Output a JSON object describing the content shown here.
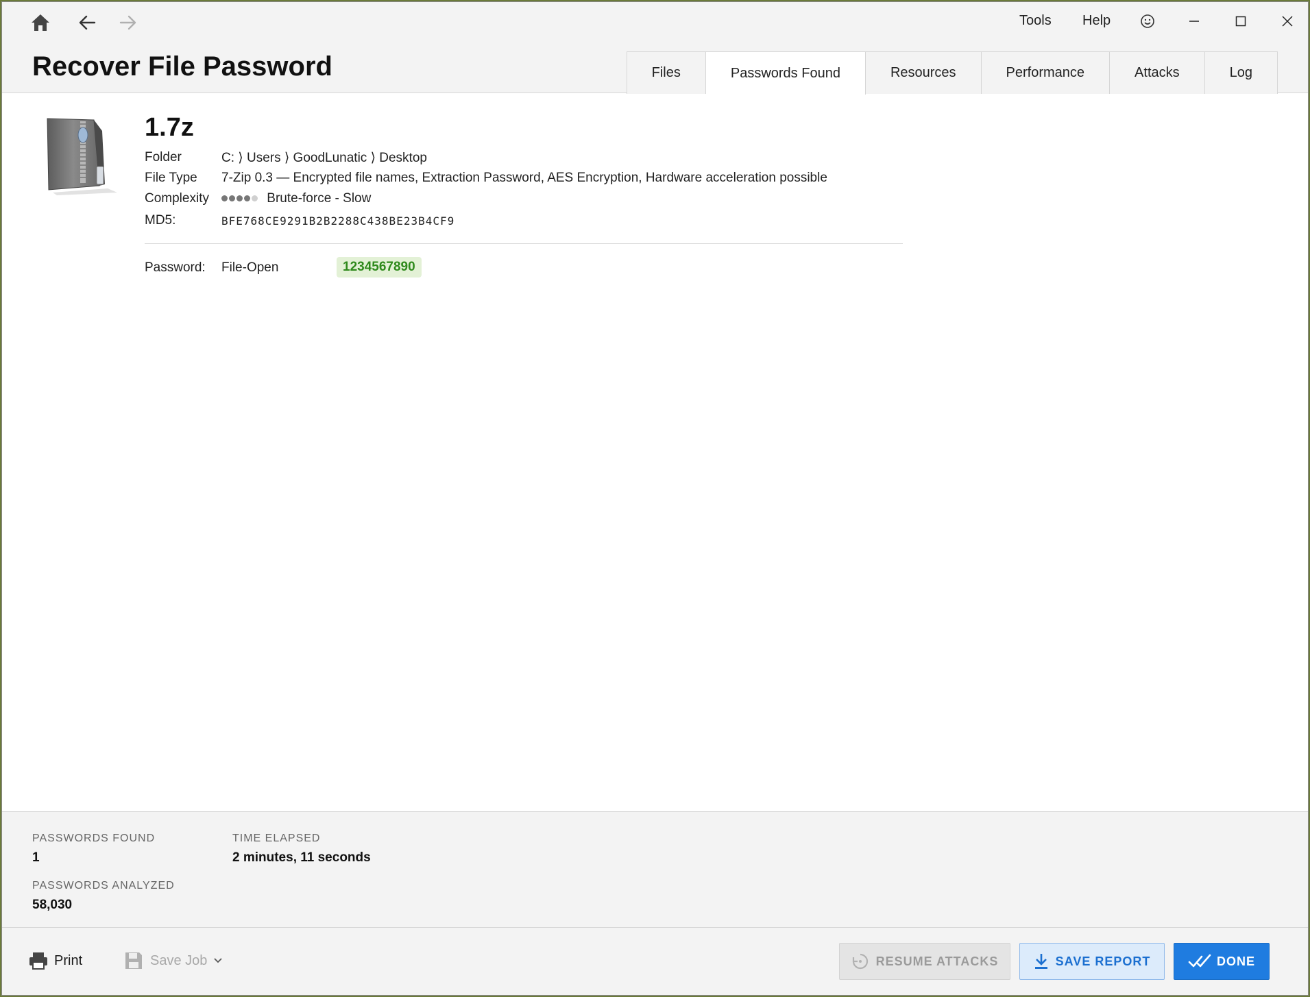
{
  "window": {
    "tools_label": "Tools",
    "help_label": "Help"
  },
  "header": {
    "title": "Recover File Password",
    "tabs": [
      {
        "label": "Files"
      },
      {
        "label": "Passwords Found"
      },
      {
        "label": "Resources"
      },
      {
        "label": "Performance"
      },
      {
        "label": "Attacks"
      },
      {
        "label": "Log"
      }
    ],
    "active_tab": "Passwords Found"
  },
  "file": {
    "name": "1.7z",
    "folder_label": "Folder",
    "folder_path": "C: ⟩ Users ⟩ GoodLunatic ⟩ Desktop",
    "filetype_label": "File Type",
    "filetype_value": "7-Zip 0.3 — Encrypted file names, Extraction Password, AES Encryption, Hardware acceleration possible",
    "complexity_label": "Complexity",
    "complexity_value": "Brute-force - Slow",
    "complexity_level": 4,
    "complexity_max": 5,
    "md5_label": "MD5:",
    "md5_value": "BFE768CE9291B2B2288C438BE23B4CF9"
  },
  "password": {
    "label": "Password:",
    "type": "File-Open",
    "value": "1234567890",
    "highlight_color": "#e3f1d6",
    "text_color": "#2f8a1c"
  },
  "stats": {
    "found_label": "PASSWORDS FOUND",
    "found_value": "1",
    "elapsed_label": "TIME ELAPSED",
    "elapsed_value": "2 minutes, 11 seconds",
    "analyzed_label": "PASSWORDS ANALYZED",
    "analyzed_value": "58,030"
  },
  "footer": {
    "print_label": "Print",
    "save_job_label": "Save Job",
    "resume_label": "RESUME ATTACKS",
    "save_report_label": "SAVE REPORT",
    "done_label": "DONE",
    "accent_color": "#1f7ce0"
  }
}
